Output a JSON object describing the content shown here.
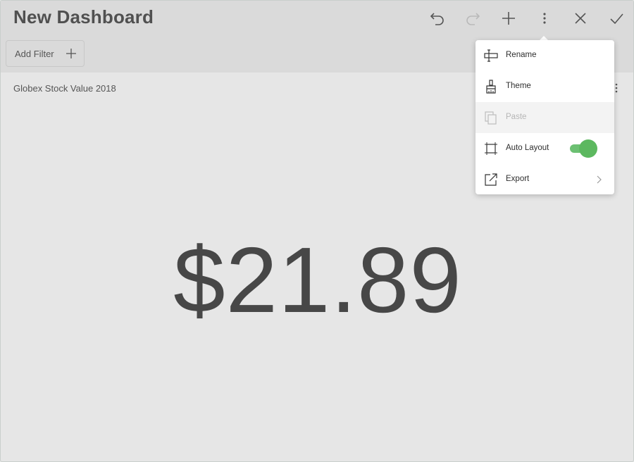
{
  "header": {
    "title": "New Dashboard",
    "actions": [
      {
        "name": "undo",
        "icon": "undo-icon",
        "enabled": true
      },
      {
        "name": "redo",
        "icon": "redo-icon",
        "enabled": false
      },
      {
        "name": "add",
        "icon": "plus-icon",
        "enabled": true
      },
      {
        "name": "more",
        "icon": "more-vertical-icon",
        "enabled": true
      },
      {
        "name": "close",
        "icon": "close-icon",
        "enabled": true
      },
      {
        "name": "done",
        "icon": "check-icon",
        "enabled": true
      }
    ]
  },
  "filter_bar": {
    "add_filter_label": "Add Filter",
    "add_filter_icon": "plus-icon"
  },
  "widget": {
    "title": "Globex Stock Value 2018",
    "value": "$21.89",
    "menu_icon": "more-vertical-icon"
  },
  "menu": {
    "items": [
      {
        "label": "Rename",
        "icon": "rename-icon",
        "enabled": true
      },
      {
        "label": "Theme",
        "icon": "paintbrush-icon",
        "enabled": true
      },
      {
        "label": "Paste",
        "icon": "paste-icon",
        "enabled": false
      },
      {
        "label": "Auto Layout",
        "icon": "auto-layout-icon",
        "enabled": true,
        "toggle_on": true
      },
      {
        "label": "Export",
        "icon": "export-icon",
        "enabled": true,
        "has_submenu": true
      }
    ]
  },
  "colors": {
    "accent_toggle": "#5cb85f",
    "header_bg": "#dadada",
    "canvas_bg": "#e6e6e6"
  }
}
